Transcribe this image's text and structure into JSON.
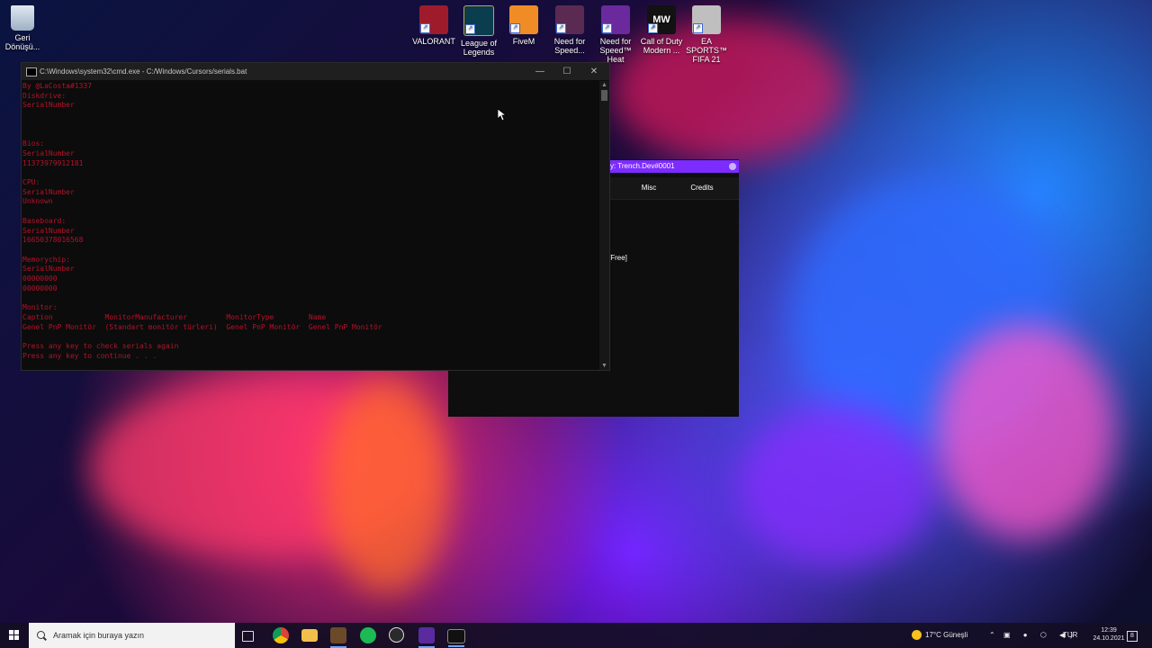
{
  "desktop": {
    "recycle_bin": {
      "label_line1": "Geri",
      "label_line2": "Dönüşü...",
      "icon": "recycle-bin-icon"
    },
    "shortcuts": [
      {
        "line1": "VALORANT",
        "line2": "",
        "icon": "valorant-icon",
        "color": "#9e1b2b"
      },
      {
        "line1": "League of",
        "line2": "Legends",
        "icon": "league-of-legends-icon",
        "color": "#0a3d4e"
      },
      {
        "line1": "FiveM",
        "line2": "",
        "icon": "fivem-icon",
        "color": "#f08c25"
      },
      {
        "line1": "Need for",
        "line2": "Speed...",
        "icon": "need-for-speed-icon",
        "color": "#5a2a52"
      },
      {
        "line1": "Need for",
        "line2": "Speed™ Heat",
        "icon": "nfs-heat-icon",
        "color": "#6a2a9e"
      },
      {
        "line1": "Call of Duty",
        "line2": "Modern ...",
        "icon": "call-of-duty-icon",
        "color": "#121212"
      },
      {
        "line1": "EA SPORTS™",
        "line2": "FIFA 21",
        "icon": "fifa-21-icon",
        "color": "#bfbfbf"
      }
    ]
  },
  "cmd_window": {
    "title": "C:\\Windows\\system32\\cmd.exe - C:/Windows/Cursors/serials.bat",
    "minimize": "—",
    "maximize": "☐",
    "close": "✕",
    "lines": [
      "By @LaCosta#1337",
      "Diskdrive:",
      "SerialNumber",
      "",
      "",
      "",
      "Bios:",
      "SerialNumber",
      "11373979912181",
      "",
      "CPU:",
      "SerialNumber",
      "Unknown",
      "",
      "Baseboard:",
      "SerialNumber",
      "16650378016568",
      "",
      "Memorychip:",
      "SerialNumber",
      "00000000",
      "00000000",
      "",
      "Monitor:",
      "Caption            MonitorManufacturer         MonitorType        Name",
      "Genel PnP Monitör  (Standart monitör türleri)  Genel PnP Monitör  Genel PnP Monitör",
      "",
      "Press any key to check serials again",
      "Press any key to continue . . ."
    ]
  },
  "trench_window": {
    "title": "y: Trench.Dev#0001",
    "tabs": [
      "Misc",
      "Credits"
    ],
    "free_label": "[Free]",
    "accent": "#7c2cff"
  },
  "taskbar": {
    "search_placeholder": "Aramak için buraya yazın",
    "apps": [
      "task-view-icon",
      "chrome-icon",
      "file-explorer-icon",
      "minecraft-icon",
      "spotify-icon",
      "obs-icon",
      "app-icon",
      "cmd-icon"
    ],
    "weather": "17°C  Güneşli",
    "language": "TUR",
    "time": "12:39",
    "date": "24.10.2021",
    "notification_count": "8"
  }
}
